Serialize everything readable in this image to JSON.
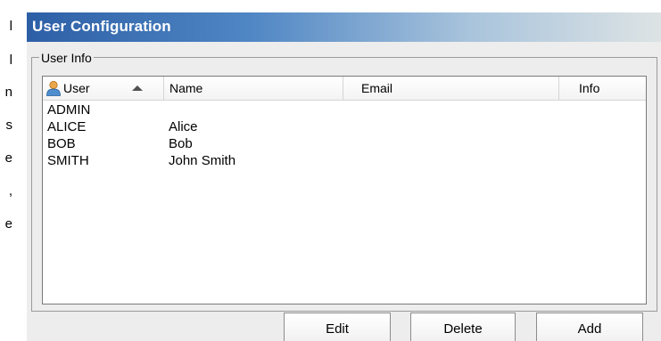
{
  "edge_text": [
    "l",
    "l",
    "n",
    "s",
    "e",
    ",",
    "e"
  ],
  "dialog": {
    "title": "User Configuration",
    "group_label": "User Info"
  },
  "list": {
    "columns": {
      "user": "User",
      "name": "Name",
      "email": "Email",
      "info": "Info"
    },
    "rows": [
      {
        "user": "ADMIN",
        "name": ""
      },
      {
        "user": "ALICE",
        "name": "Alice"
      },
      {
        "user": "BOB",
        "name": "Bob"
      },
      {
        "user": "SMITH",
        "name": "John Smith"
      }
    ]
  },
  "buttons": {
    "edit": "Edit",
    "delete": "Delete",
    "add": "Add"
  },
  "icons": {
    "user_column": "user-icon",
    "sort": "sort-ascending-icon"
  }
}
